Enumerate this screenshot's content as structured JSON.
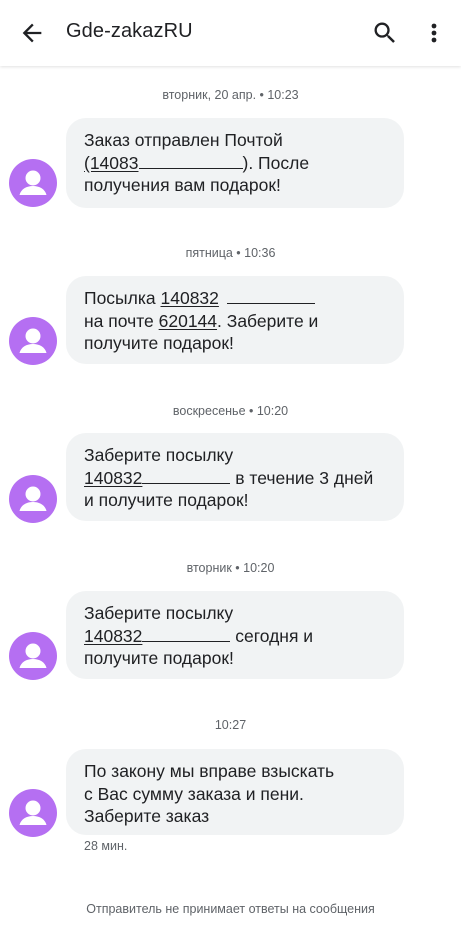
{
  "header": {
    "title": "Gde-zakazRU",
    "back_icon": "arrow-back-icon",
    "search_icon": "search-icon",
    "more_icon": "more-vert-icon"
  },
  "colors": {
    "avatar": "#b56ff2",
    "bubble": "#f1f3f4",
    "meta_text": "#5f6368"
  },
  "messages": [
    {
      "timestamp": "вторник, 20 апр. • 10:23",
      "lines": [
        "Заказ отправлен Почтой",
        "(14083",
        "). После",
        "получения вам подарок!"
      ]
    },
    {
      "timestamp": "пятница • 10:36",
      "lines": [
        "Посылка ",
        "140832",
        "на почте ",
        "620144",
        ". Заберите и",
        "получите подарок!"
      ]
    },
    {
      "timestamp": "воскресенье • 10:20",
      "lines": [
        "Заберите посылку",
        "140832",
        " в течение 3 дней",
        "и получите подарок!"
      ]
    },
    {
      "timestamp": "вторник • 10:20",
      "lines": [
        "Заберите посылку",
        "140832",
        " сегодня и",
        "получите подарок!"
      ]
    },
    {
      "timestamp": "10:27",
      "lines": [
        "По закону мы вправе взыскать",
        "с Вас сумму заказа и пени.",
        "Заберите заказ"
      ],
      "sent_ago": "28 мин."
    }
  ],
  "footer": {
    "note": "Отправитель не принимает ответы на сообщения"
  }
}
